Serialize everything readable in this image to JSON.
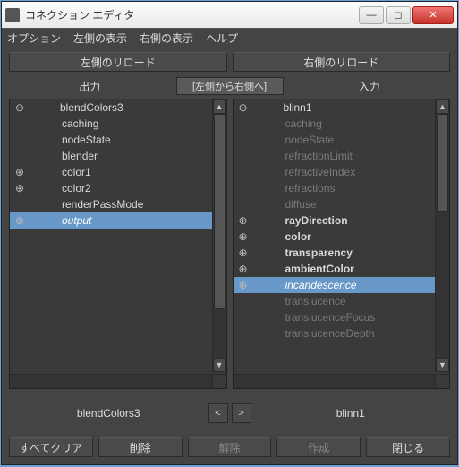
{
  "window": {
    "title": "コネクション エディタ"
  },
  "menu": {
    "options": "オプション",
    "left_display": "左側の表示",
    "right_display": "右側の表示",
    "help": "ヘルプ"
  },
  "reload": {
    "left": "左側のリロード",
    "right": "右側のリロード"
  },
  "header": {
    "outputs": "出力",
    "direction": "[左側から右側へ]",
    "inputs": "入力"
  },
  "left": {
    "root": "blendColors3",
    "items": [
      {
        "label": "caching",
        "exp": "",
        "dim": false
      },
      {
        "label": "nodeState",
        "exp": "",
        "dim": false
      },
      {
        "label": "blender",
        "exp": "",
        "dim": false
      },
      {
        "label": "color1",
        "exp": "⊕",
        "dim": false
      },
      {
        "label": "color2",
        "exp": "⊕",
        "dim": false
      },
      {
        "label": "renderPassMode",
        "exp": "",
        "dim": false
      },
      {
        "label": "output",
        "exp": "⊕",
        "dim": false,
        "selected": true,
        "italic": true
      }
    ]
  },
  "right": {
    "root": "blinn1",
    "items": [
      {
        "label": "caching",
        "exp": "",
        "dim": true
      },
      {
        "label": "nodeState",
        "exp": "",
        "dim": true
      },
      {
        "label": "refractionLimit",
        "exp": "",
        "dim": true
      },
      {
        "label": "refractiveIndex",
        "exp": "",
        "dim": true
      },
      {
        "label": "refractions",
        "exp": "",
        "dim": true
      },
      {
        "label": "diffuse",
        "exp": "",
        "dim": true
      },
      {
        "label": "rayDirection",
        "exp": "⊕",
        "bold": true
      },
      {
        "label": "color",
        "exp": "⊕",
        "bold": true
      },
      {
        "label": "transparency",
        "exp": "⊕",
        "bold": true
      },
      {
        "label": "ambientColor",
        "exp": "⊕",
        "bold": true
      },
      {
        "label": "incandescence",
        "exp": "⊕",
        "selected": true,
        "italic": true
      },
      {
        "label": "translucence",
        "exp": "",
        "dim": true
      },
      {
        "label": "translucenceFocus",
        "exp": "",
        "dim": true
      },
      {
        "label": "translucenceDepth",
        "exp": "",
        "dim": true
      }
    ]
  },
  "status": {
    "left": "blendColors3",
    "right": "blinn1",
    "prev": "<",
    "next": ">"
  },
  "buttons": {
    "clear_all": "すべてクリア",
    "delete": "削除",
    "release": "解除",
    "create": "作成",
    "close": "閉じる"
  }
}
